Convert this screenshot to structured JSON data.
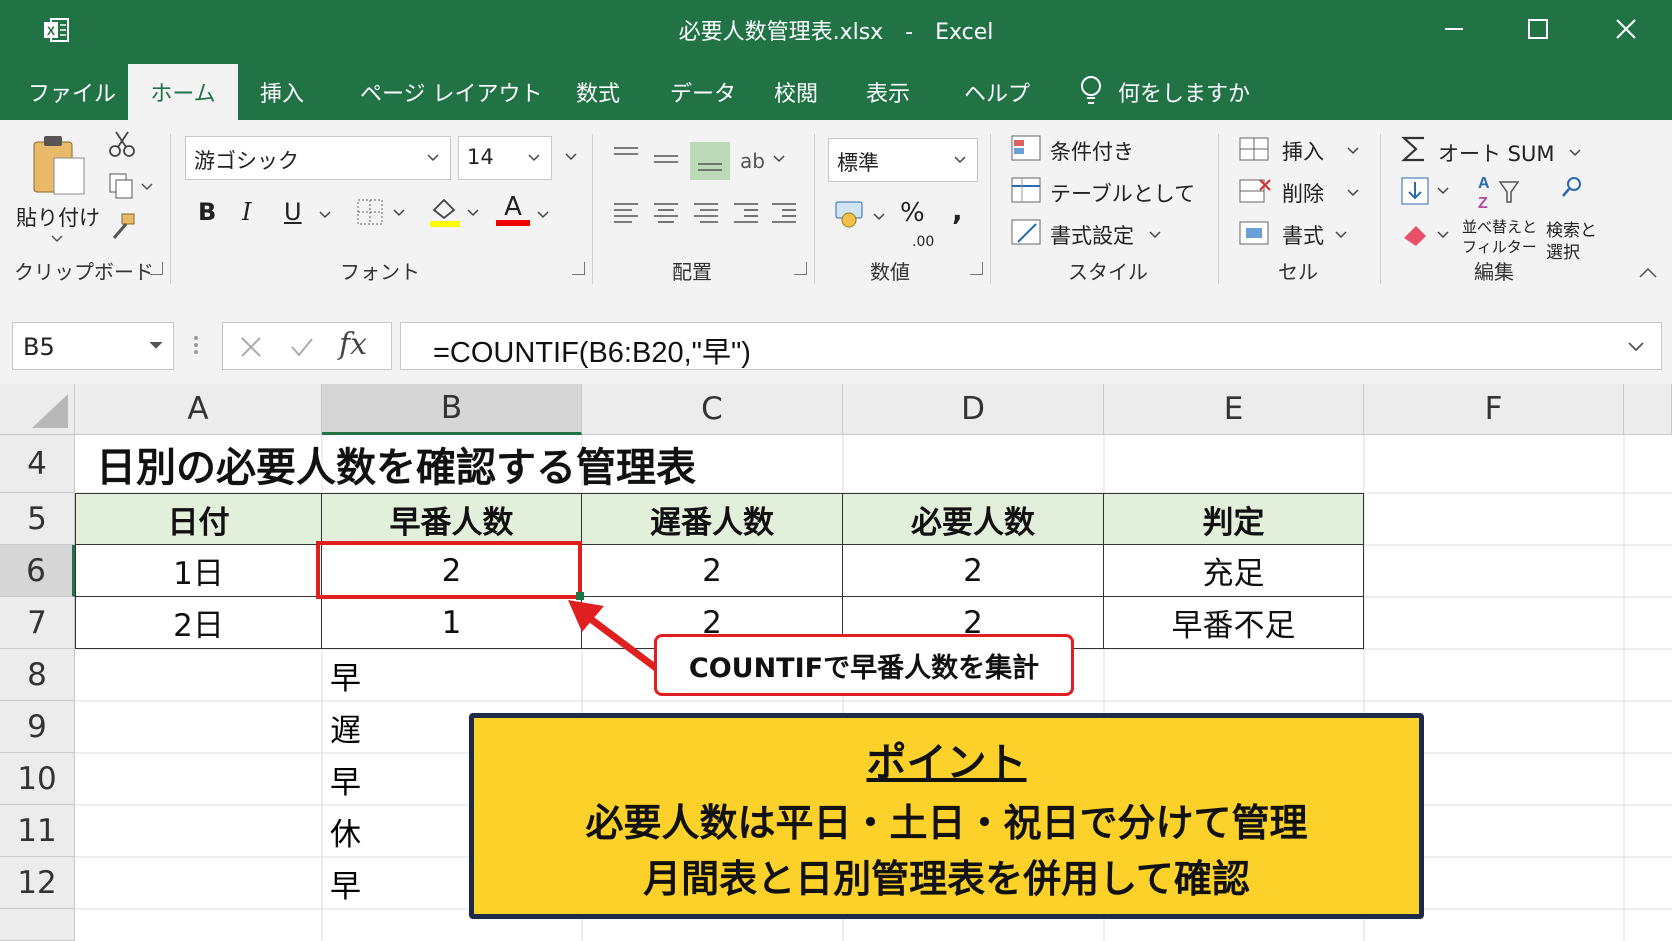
{
  "window": {
    "title": "必要人数管理表.xlsx　-　Excel",
    "app_icon": "excel-icon"
  },
  "tabs": [
    "ファイル",
    "ホーム",
    "挿入",
    "ページ レイアウト",
    "数式",
    "データ",
    "校閲",
    "表示",
    "ヘルプ"
  ],
  "tell_me": "何をしますか",
  "ribbon": {
    "clipboard": {
      "paste": "貼り付け",
      "label": "クリップボード"
    },
    "font": {
      "name": "游ゴシック",
      "size": "14",
      "bold": "B",
      "italic": "I",
      "underline": "U",
      "color_a": "A",
      "label": "フォント"
    },
    "alignment": {
      "label": "配置"
    },
    "number": {
      "format": "標準",
      "percent": "%",
      "comma": ",",
      "decimal": ".00",
      "label": "数値"
    },
    "styles": {
      "conditional": "条件付き",
      "as_table": "テーブルとして",
      "cell_style": "書式設定",
      "label": "スタイル"
    },
    "cells": {
      "insert": "挿入",
      "delete": "削除",
      "format": "書式",
      "label": "セル"
    },
    "editing": {
      "autosum": "オート SUM",
      "sort_line1": "並べ替えと",
      "sort_line2": "フィルター",
      "find_line1": "検索と",
      "find_line2": "選択",
      "label": "編集"
    }
  },
  "formula_bar": {
    "name_box": "B5",
    "fx": "fx",
    "formula": "=COUNTIF(B6:B20,\"早\")"
  },
  "columns": [
    "A",
    "B",
    "C",
    "D",
    "E",
    "F"
  ],
  "rows": [
    "4",
    "5",
    "6",
    "7",
    "8",
    "9",
    "10",
    "11",
    "12"
  ],
  "sheet": {
    "title": "日別の必要人数を確認する管理表",
    "headers": [
      "日付",
      "早番人数",
      "遅番人数",
      "必要人数",
      "判定"
    ],
    "data_rows": [
      [
        "1日",
        "2",
        "2",
        "2",
        "充足"
      ],
      [
        "2日",
        "1",
        "2",
        "2",
        "早番不足"
      ]
    ],
    "shift_list": [
      "早",
      "遅",
      "早",
      "休",
      "早"
    ]
  },
  "callout": {
    "text": "COUNTIFで早番人数を集計"
  },
  "point_box": {
    "title": "ポイント",
    "line1": "必要人数は平日・土日・祝日で分けて管理",
    "line2": "月間表と日別管理表を併用して確認"
  },
  "colors": {
    "excel_green": "#217346",
    "header_fill": "#e2efda",
    "highlight_red": "#e02020",
    "point_yellow": "#fcd22a",
    "point_border": "#1e2a4a"
  }
}
